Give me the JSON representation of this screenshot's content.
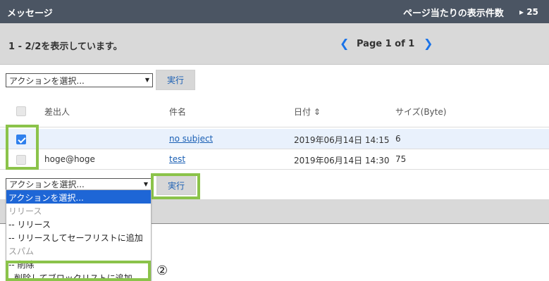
{
  "header": {
    "title": "メッセージ",
    "perpage_label": "ページ当たりの表示件数",
    "perpage_value": "▸ 25"
  },
  "paging": {
    "count_text": "1 - 2/2を表示しています。",
    "prev_glyph": "❮",
    "page_text": "Page 1 of 1",
    "next_glyph": "❯"
  },
  "actions_top": {
    "select_value": "アクションを選択...",
    "execute_label": "実行"
  },
  "table": {
    "columns": [
      "差出人",
      "件名",
      "日付 ⇕",
      "サイズ(Byte)"
    ],
    "rows": [
      {
        "checked": true,
        "sender": "",
        "subject": "no subject",
        "date": "2019年06月14日 14:15",
        "size": "6"
      },
      {
        "checked": false,
        "sender": "hoge@hoge",
        "subject": "test",
        "date": "2019年06月14日 14:30",
        "size": "75"
      }
    ]
  },
  "actions_bottom": {
    "select_value": "アクションを選択...",
    "execute_label": "実行"
  },
  "dropdown": {
    "options": [
      "アクションを選択...",
      "リリース",
      "-- リリース",
      "-- リリースしてセーフリストに追加",
      "スパム",
      "-- 削除",
      "- 削除してブロックリストに追加"
    ]
  },
  "annotation": {
    "marker": "②"
  },
  "colors": {
    "header_bg": "#4b5563",
    "bar_bg": "#d9d9d9",
    "link": "#1a5fb4",
    "accent": "#2f80ed",
    "highlight_box": "#8bc34a",
    "dropdown_highlight": "#1e66d6"
  }
}
